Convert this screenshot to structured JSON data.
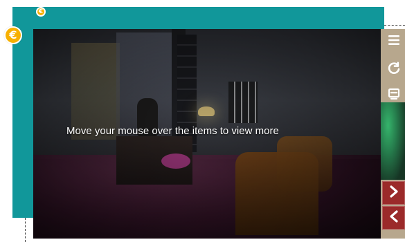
{
  "overlay": {
    "instruction": "Move your mouse over the items to view more"
  },
  "icons": {
    "menu": "hamburger-menu-icon",
    "refresh": "refresh-icon",
    "caption": "caption-icon",
    "next": "chevron-right-icon",
    "previous": "chevron-left-icon",
    "badge": "currency-badge-icon"
  },
  "colors": {
    "frame": "#11979a",
    "toolbar": "#b7a78d",
    "nav": "#9b2a2a",
    "badge": "#f7b000"
  }
}
